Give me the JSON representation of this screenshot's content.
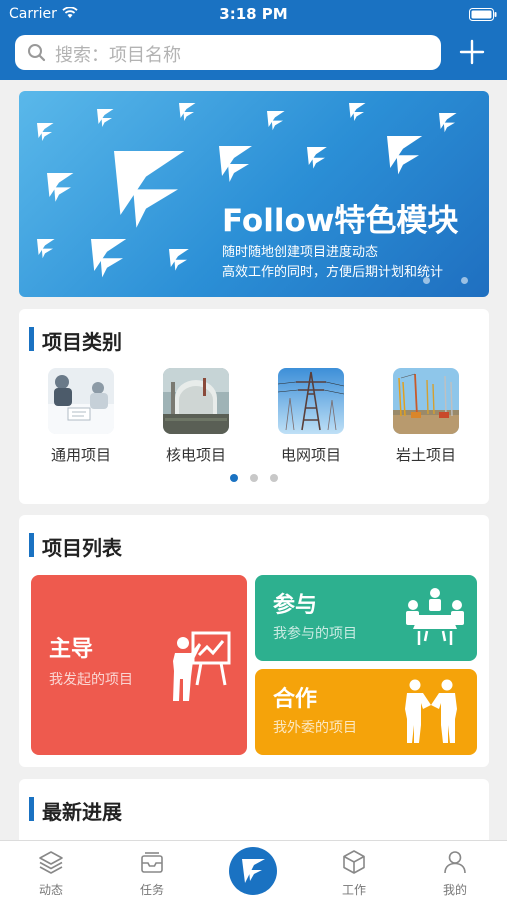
{
  "status_bar": {
    "carrier": "Carrier",
    "time": "3:18 PM"
  },
  "search": {
    "placeholder": "搜索：项目名称"
  },
  "banner": {
    "title": "Follow特色模块",
    "line1": "随时随地创建项目进度动态",
    "line2": "高效工作的同时，方便后期计划和统计"
  },
  "categories": {
    "title": "项目类别",
    "items": [
      {
        "label": "通用项目",
        "icon": "meeting-photo"
      },
      {
        "label": "核电项目",
        "icon": "nuclear-plant-photo"
      },
      {
        "label": "电网项目",
        "icon": "power-tower-photo"
      },
      {
        "label": "岩土项目",
        "icon": "construction-site-photo"
      }
    ]
  },
  "projects": {
    "title": "项目列表",
    "lead": {
      "title": "主导",
      "subtitle": "我发起的项目",
      "color": "#ee5a4e"
    },
    "join": {
      "title": "参与",
      "subtitle": "我参与的项目",
      "color": "#2db08f"
    },
    "coop": {
      "title": "合作",
      "subtitle": "我外委的项目",
      "color": "#f5a30a"
    }
  },
  "latest": {
    "title": "最新进展"
  },
  "tabbar": {
    "items": [
      {
        "label": "动态",
        "icon": "layers-icon"
      },
      {
        "label": "任务",
        "icon": "inbox-icon"
      },
      {
        "label": "",
        "icon": "follow-logo-icon"
      },
      {
        "label": "工作",
        "icon": "cube-icon"
      },
      {
        "label": "我的",
        "icon": "user-icon"
      }
    ]
  },
  "colors": {
    "primary": "#1a72c2",
    "background": "#f0f0f0"
  }
}
